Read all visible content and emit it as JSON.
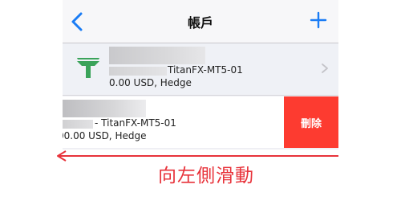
{
  "navbar": {
    "title": "帳戶",
    "back_icon": "chevron-left-icon",
    "add_icon": "plus-icon"
  },
  "accounts": [
    {
      "server": "TitanFX-MT5-01",
      "balance": "0.00 USD, Hedge",
      "logo_icon": "titanfx-logo-icon"
    },
    {
      "server": "- TitanFX-MT5-01",
      "balance": "00.00 USD, Hedge",
      "delete_label": "刪除"
    }
  ],
  "annotation": {
    "text": "向左側滑動"
  },
  "colors": {
    "accent_blue": "#1a7cf5",
    "delete_red": "#fd3b30",
    "annotation_red": "#e8333b",
    "logo_green": "#3aa35a"
  }
}
